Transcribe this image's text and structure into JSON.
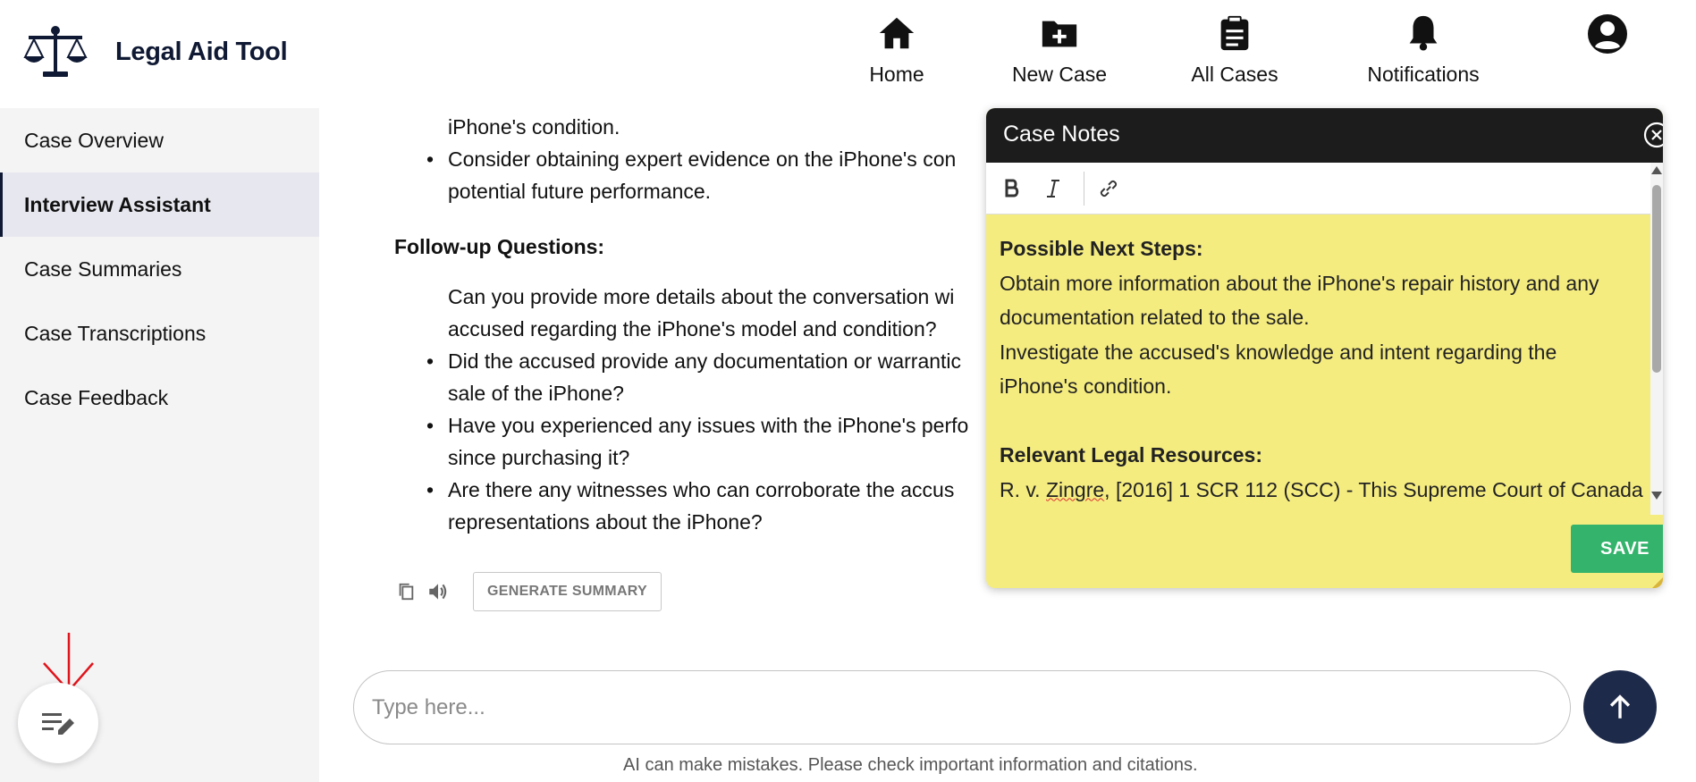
{
  "header": {
    "app_title": "Legal Aid Tool",
    "nav": [
      {
        "label": "Home",
        "icon": "home-icon"
      },
      {
        "label": "New Case",
        "icon": "folder-plus-icon"
      },
      {
        "label": "All Cases",
        "icon": "clipboard-icon"
      },
      {
        "label": "Notifications",
        "icon": "bell-icon"
      }
    ],
    "profile_icon": "account-circle-icon"
  },
  "sidebar": {
    "items": [
      {
        "label": "Case Overview",
        "active": false
      },
      {
        "label": "Interview Assistant",
        "active": true
      },
      {
        "label": "Case Summaries",
        "active": false
      },
      {
        "label": "Case Transcriptions",
        "active": false
      },
      {
        "label": "Case Feedback",
        "active": false
      }
    ],
    "notes_button_icon": "notes-edit-icon"
  },
  "main": {
    "recommendations_tail": [
      "iPhone's condition.",
      "Consider obtaining expert evidence on the iPhone's con",
      "potential future performance."
    ],
    "followup_title": "Follow-up Questions:",
    "followup_questions": [
      [
        "Can you provide more details about the conversation wi",
        "accused regarding the iPhone's model and condition?"
      ],
      [
        "Did the accused provide any documentation or warrantic",
        "sale of the iPhone?"
      ],
      [
        "Have you experienced any issues with the iPhone's perfo",
        "since purchasing it?"
      ],
      [
        "Are there any witnesses who can corroborate the accus",
        "representations about the iPhone?"
      ]
    ],
    "generate_summary_label": "GENERATE SUMMARY",
    "chat_placeholder": "Type here...",
    "disclaimer": "AI can make mistakes. Please check important information and citations."
  },
  "case_notes": {
    "title": "Case Notes",
    "heading_1": "Possible Next Steps:",
    "line_1": "Obtain more information about the iPhone's repair history and any",
    "line_2": "documentation related to the sale.",
    "line_3": "Investigate the accused's knowledge and intent regarding the",
    "line_4": "iPhone's condition.",
    "heading_2": "Relevant Legal Resources:",
    "line_5_prefix": "R. v. ",
    "line_5_name": "Zingre",
    "line_5_suffix": ", [2016] 1 SCR 112 (SCC) - This Supreme Court of Canada",
    "save_label": "SAVE"
  },
  "colors": {
    "brand_navy": "#0f1933",
    "notes_yellow": "#f5ec80",
    "save_green": "#33b36b",
    "annotation_red": "#e0151c"
  }
}
